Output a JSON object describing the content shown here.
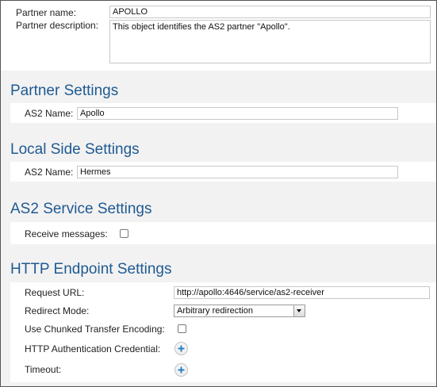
{
  "partner": {
    "name_label": "Partner name:",
    "name_value": "APOLLO",
    "description_label": "Partner description:",
    "description_value": "This object identifies the AS2 partner \"Apollo\"."
  },
  "partner_settings": {
    "title": "Partner Settings",
    "as2_name_label": "AS2 Name:",
    "as2_name_value": "Apollo"
  },
  "local_side_settings": {
    "title": "Local Side Settings",
    "as2_name_label": "AS2 Name:",
    "as2_name_value": "Hermes"
  },
  "as2_service_settings": {
    "title": "AS2 Service Settings",
    "receive_messages_label": "Receive messages:",
    "receive_messages_checked": false
  },
  "http_endpoint_settings": {
    "title": "HTTP Endpoint Settings",
    "request_url_label": "Request URL:",
    "request_url_value": "http://apollo:4646/service/as2-receiver",
    "redirect_mode_label": "Redirect Mode:",
    "redirect_mode_value": "Arbitrary redirection",
    "chunked_label": "Use Chunked Transfer Encoding:",
    "chunked_checked": false,
    "auth_credential_label": "HTTP Authentication Credential:",
    "timeout_label": "Timeout:"
  },
  "icons": {
    "add": "plus-circle-icon",
    "dropdown": "chevron-down-icon"
  },
  "colors": {
    "section_title": "#1f5a92",
    "background": "#f2f2f2",
    "add_icon": "#2a7fc1"
  }
}
